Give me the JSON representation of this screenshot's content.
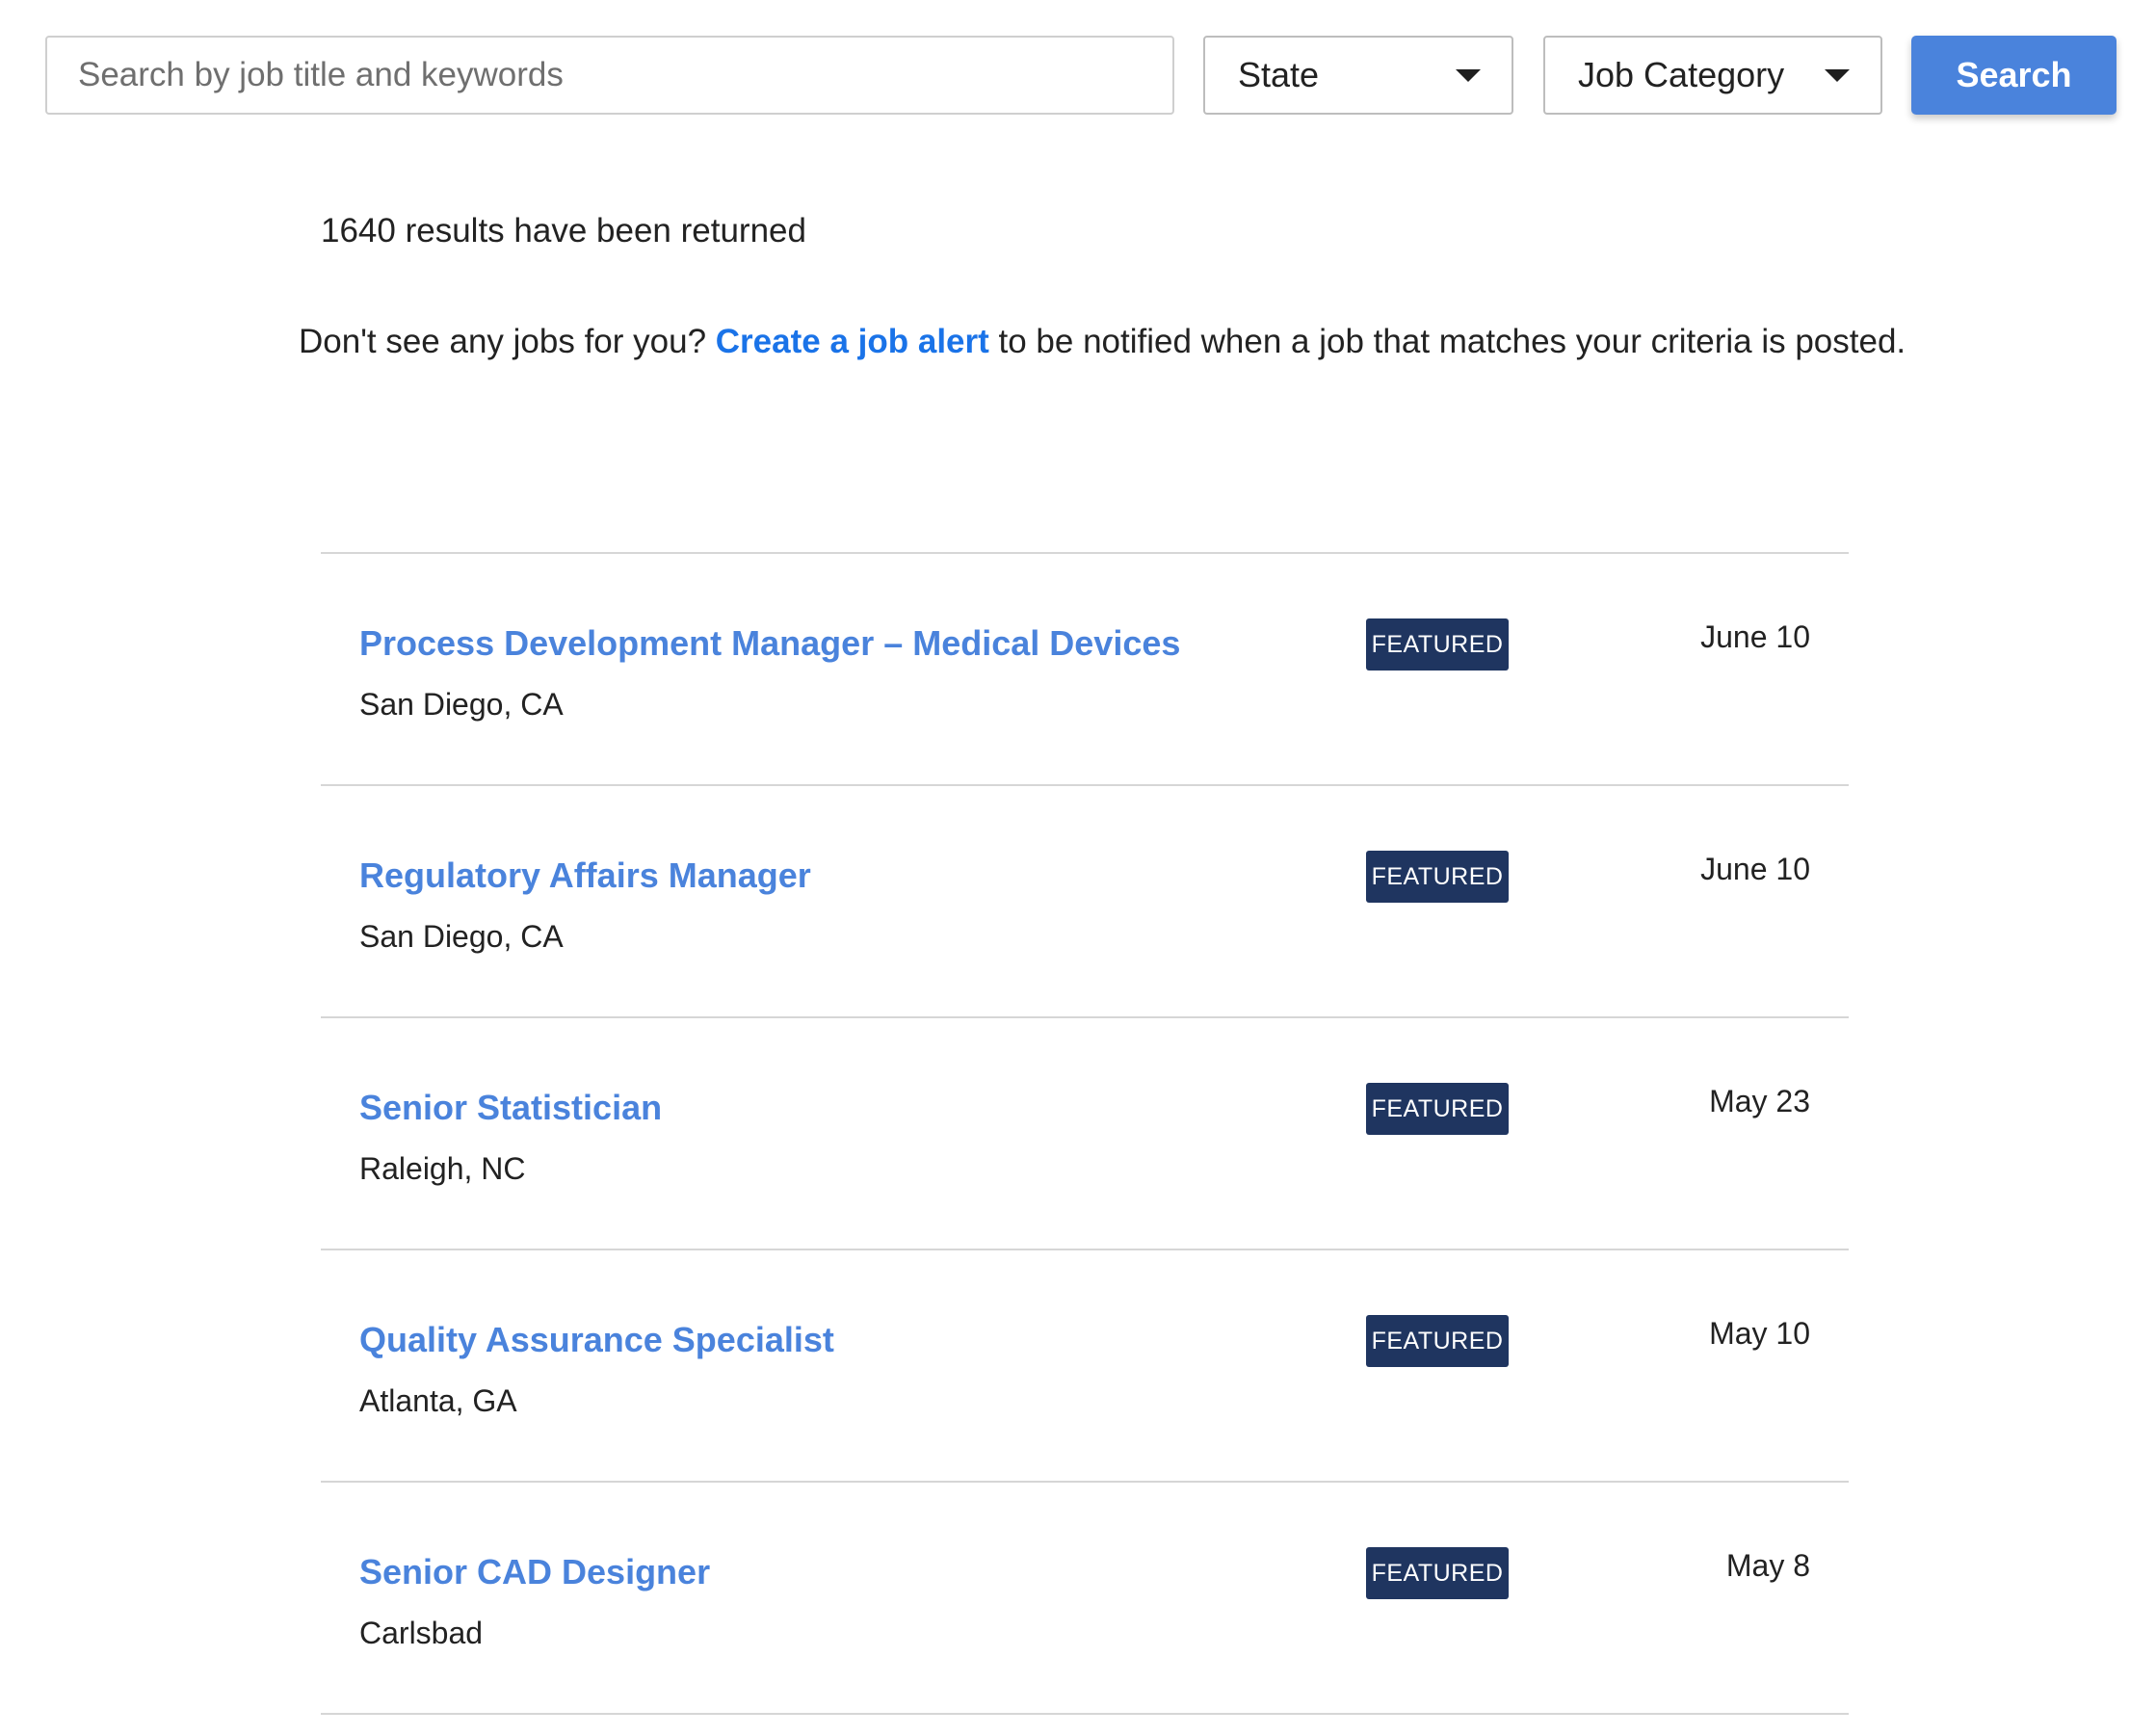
{
  "search": {
    "placeholder": "Search by job title and keywords",
    "value": "",
    "state_label": "State",
    "category_label": "Job Category",
    "button_label": "Search"
  },
  "results": {
    "count_text": "1640 results have been returned",
    "alert_prefix": "Don't see any jobs for you? ",
    "alert_link": "Create a job alert",
    "alert_suffix": " to be notified when a job that matches your criteria is posted."
  },
  "jobs": [
    {
      "title": "Process Development Manager – Medical Devices",
      "location": "San Diego, CA",
      "badge": "FEATURED",
      "date": "June 10"
    },
    {
      "title": "Regulatory Affairs Manager",
      "location": "San Diego, CA",
      "badge": "FEATURED",
      "date": "June 10"
    },
    {
      "title": "Senior Statistician",
      "location": "Raleigh, NC",
      "badge": "FEATURED",
      "date": "May 23"
    },
    {
      "title": "Quality Assurance Specialist",
      "location": "Atlanta, GA",
      "badge": "FEATURED",
      "date": "May 10"
    },
    {
      "title": "Senior CAD Designer",
      "location": "Carlsbad",
      "badge": "FEATURED",
      "date": "May 8"
    }
  ],
  "colors": {
    "accent": "#4a83dc",
    "link": "#1a73e8",
    "badge_bg": "#1f3560"
  }
}
